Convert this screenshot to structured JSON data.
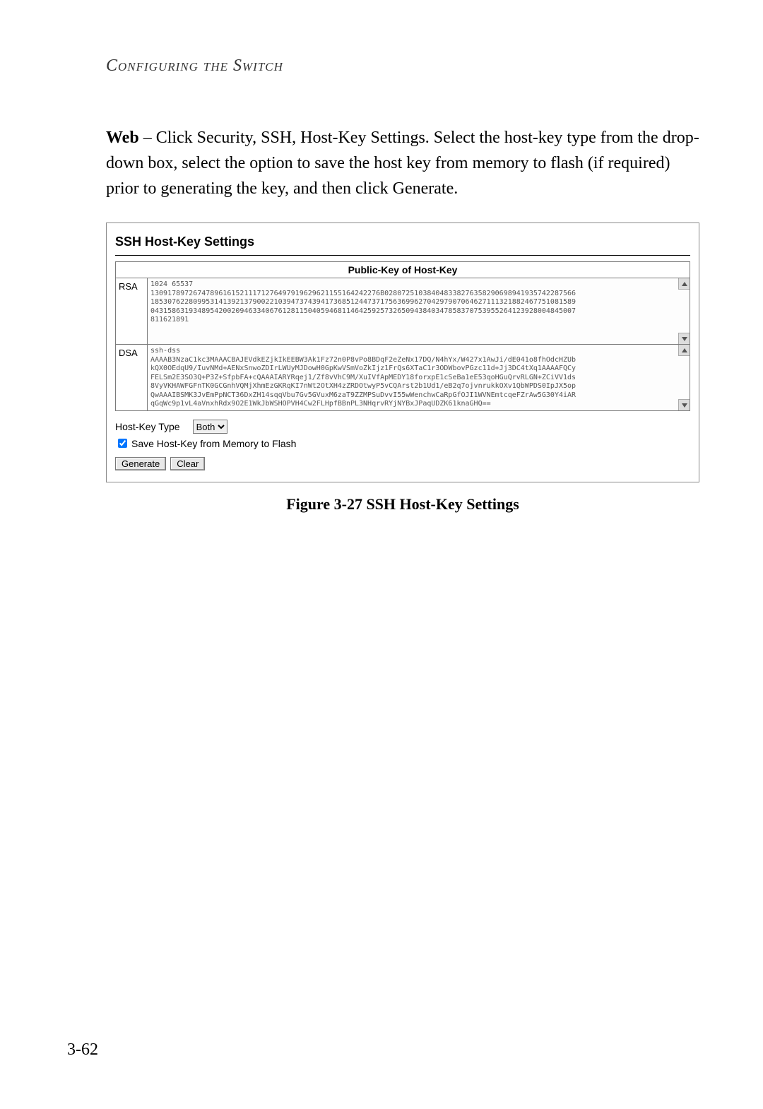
{
  "header": "Configuring the Switch",
  "body_html_prefix": "Web",
  "body_text": " – Click Security, SSH, Host-Key Settings. Select the host-key type from the drop-down box, select the option to save the host key from memory to flash (if required) prior to generating the key, and then click Generate.",
  "panel": {
    "title": "SSH Host-Key Settings",
    "pubkey_header": "Public-Key of Host-Key",
    "rows": [
      {
        "label": "RSA",
        "value": "1024 65537\n130917897267478961615211171276497919629621155164242276B028072510384048338276358290698941935742287566\n1853076228099531413921379002210394737439417368512447371756369962704297907064627111321882467751081589\n0431586319348954200209463340676128115040594681146425925732650943840347858370753955264123928004845007\n811621891"
      },
      {
        "label": "DSA",
        "value": "ssh-dss\nAAAAB3NzaC1kc3MAAACBAJEVdkEZjkIkEEBW3Ak1Fz72n0P8vPo8BDqF2eZeNx17DQ/N4hYx/W427x1AwJi/dE041o8fhOdcHZUb\nkQX0OEdqU9/IuvNMd+AENxSnwoZDIrLWUyMJDowH0GpKwVSmVoZkIjz1FrQs6XTaC1r3ODWbovPGzc11d+Jj3DC4tXq1AAAAFQCy\nFELSm2E3SO3Q+P3Z+SfpbFA+cQAAAIARYRqej1/Zf8vVhC9M/XuIVfApMEDY18forxpE1cSeBa1eE53qoHGuQrvRLGN+ZCiVV1ds\n8VyVKHAWFGFnTK0GCGnhVQMjXhmEzGKRqKI7nWt2OtXH4zZRDOtwyP5vCQArst2b1Ud1/eB2q7ojvnrukkOXv1QbWPDS0IpJX5op\nQwAAAIBSMK3JvEmPpNCT36DxZH14sqqVbu7Gv5GVuxM6zaT9ZZMPSuDvvI55wWenchwCaRpGfOJI1WVNEmtcqeFZrAw5G30Y4iAR\nqGqWc9p1vL4aVnxhRdx9O2E1WkJbWSHOPVH4Cw2FLHpfBBnPL3NHqrvRYjNYBxJPaqUDZK61knaGHQ=="
      }
    ],
    "hostkey_type_label": "Host-Key Type",
    "hostkey_type_value": "Both",
    "save_checkbox_label": "Save Host-Key from Memory to Flash",
    "save_checked": true,
    "generate_btn": "Generate",
    "clear_btn": "Clear"
  },
  "caption": "Figure 3-27  SSH Host-Key Settings",
  "page_number": "3-62"
}
